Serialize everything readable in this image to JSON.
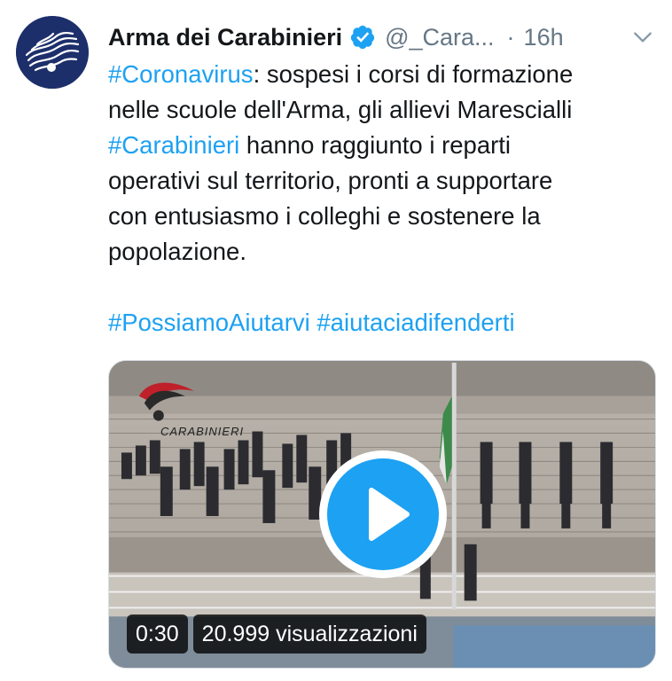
{
  "author": {
    "name": "Arma dei Carabinieri",
    "handle": "@_Cara...",
    "separator": "·",
    "time": "16h",
    "verified": true
  },
  "tweet": {
    "segments": [
      [
        {
          "text": "#Coronavirus",
          "hashtag": true
        },
        {
          "text": ": sospesi i corsi di formazione",
          "hashtag": false
        }
      ],
      [
        {
          "text": "nelle scuole dell'Arma, gli allievi Marescialli",
          "hashtag": false
        }
      ],
      [
        {
          "text": "#Carabinieri",
          "hashtag": true
        },
        {
          "text": " hanno raggiunto i reparti",
          "hashtag": false
        }
      ],
      [
        {
          "text": "operativi sul territorio, pronti a supportare",
          "hashtag": false
        }
      ],
      [
        {
          "text": "con entusiasmo i colleghi e sostenere la",
          "hashtag": false
        }
      ],
      [
        {
          "text": "popolazione.",
          "hashtag": false
        }
      ],
      [],
      [
        {
          "text": "#PossiamoAiutarvi",
          "hashtag": true
        },
        {
          "text": " ",
          "hashtag": false
        },
        {
          "text": "#aiutaciadifenderti",
          "hashtag": true
        }
      ]
    ]
  },
  "media": {
    "watermark": "CARABINIERI",
    "duration": "0:30",
    "views": "20.999 visualizzazioni"
  },
  "colors": {
    "link": "#1da1f2",
    "secondary_text": "#657786",
    "avatar_bg": "#1d2f6b",
    "play_button": "#1da1f2"
  },
  "icons": {
    "verified": "verified-badge-icon",
    "menu": "chevron-down-icon",
    "play": "play-icon"
  }
}
